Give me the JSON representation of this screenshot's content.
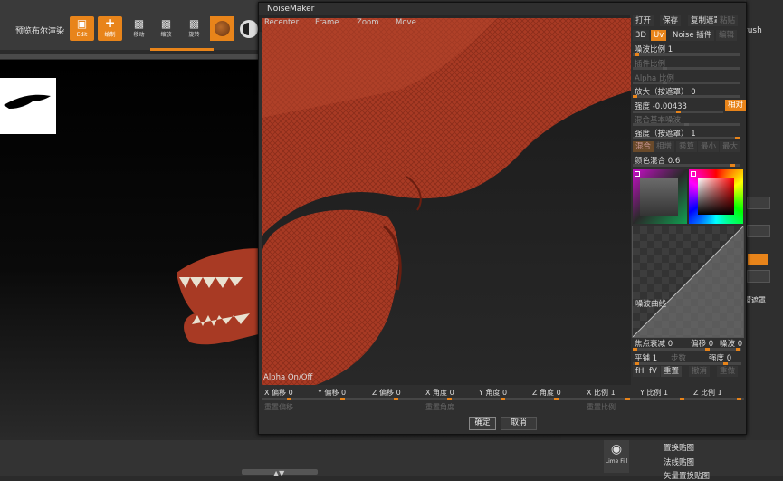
{
  "app": {
    "toolbar": {
      "tool_label": "预览布尔渲染",
      "tools": [
        {
          "label": "Edit",
          "icon": "edit-icon",
          "active": true
        },
        {
          "label": "绘制",
          "icon": "draw-icon",
          "active": true
        },
        {
          "label": "移动",
          "icon": "move-icon",
          "active": false
        },
        {
          "label": "缩放",
          "icon": "scale-icon",
          "active": false
        },
        {
          "label": "旋转",
          "icon": "rotate-icon",
          "active": false
        }
      ],
      "top_right_text": "rush"
    },
    "right_panel": {
      "mask_label": "蒙遮罩"
    },
    "menu_items": [
      "置换贴图",
      "法线贴图",
      "矢量置换贴图"
    ],
    "lime_fill": "Lime Fill"
  },
  "dialog": {
    "title": "NoiseMaker",
    "menu": [
      "Recenter",
      "Frame",
      "Zoom",
      "Move"
    ],
    "alpha_onoff": "Alpha On/Off",
    "top_buttons": [
      "打开",
      "保存",
      "复制遮罩",
      "粘贴"
    ],
    "mode_tabs": [
      "3D",
      "Uv",
      "Noise 插件",
      "编辑"
    ],
    "rows": {
      "noise_scale": {
        "label": "噪波比例",
        "value": "1",
        "level": 0.02
      },
      "strength_scale": {
        "label": "插件比例",
        "level": 0.3
      },
      "alpha_scale": {
        "label": "Alpha 比例",
        "level": 0.3
      },
      "magnify_mask": {
        "label": "放大（按遮罩）",
        "value": "0",
        "level": 0.0
      },
      "strength": {
        "label": "强度",
        "value": "-0.00433",
        "level": 0.5,
        "relative_label": "相对"
      },
      "blend_base": {
        "label": "混合基本噪波",
        "level": 0.5
      },
      "strength_mask": {
        "label": "强度（按遮罩）",
        "value": "1",
        "level": 1.0
      },
      "blend_modes": [
        "混合",
        "相增",
        "乘算",
        "最小",
        "最大"
      ],
      "color_blend": {
        "label": "颜色混合",
        "value": "0.6",
        "level": 0.6
      },
      "noise_curve": "噪波曲线",
      "focal_falloff": {
        "label": "焦点衰减",
        "value": "0"
      },
      "offset": {
        "label": "偏移",
        "value": "0"
      },
      "noise": {
        "label": "噪波",
        "value": "0"
      },
      "smooth": {
        "label": "平铺",
        "value": "1"
      },
      "steps": {
        "label": "步数"
      },
      "strength2": {
        "label": "强度",
        "value": "0"
      },
      "fh": "fH",
      "fv": "fV",
      "reset": "重置",
      "undo": "撤消",
      "redo": "重做"
    },
    "bottom_params": [
      {
        "label": "X 偏移",
        "value": "0"
      },
      {
        "label": "Y 偏移",
        "value": "0"
      },
      {
        "label": "Z 偏移",
        "value": "0"
      },
      {
        "label": "X 角度",
        "value": "0"
      },
      {
        "label": "Y 角度",
        "value": "0"
      },
      {
        "label": "Z 角度",
        "value": "0"
      },
      {
        "label": "X 比例",
        "value": "1"
      },
      {
        "label": "Y 比例",
        "value": "1"
      },
      {
        "label": "Z 比例",
        "value": "1"
      }
    ],
    "reset_offset": "重置偏移",
    "reset_angle": "重置角度",
    "reset_scale": "重置比例",
    "ok": "确定",
    "cancel": "取消"
  },
  "colors": {
    "accent": "#e8841a",
    "model": "#a83a24"
  }
}
